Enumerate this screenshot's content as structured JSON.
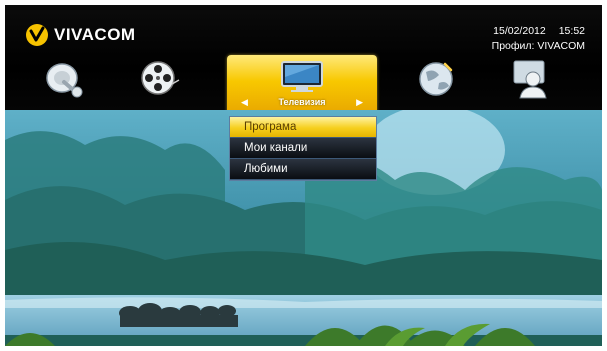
{
  "brand": {
    "logo_text": "VIVACOM",
    "accent": "#f6c200"
  },
  "status": {
    "date": "15/02/2012",
    "time": "15:52",
    "profile": "Профил: VIVACOM"
  },
  "menu": {
    "icons": [
      "radio-satellite-icon",
      "film-reel-icon",
      "tv-icon",
      "globe-icon",
      "user-profile-icon"
    ],
    "selected_label": "Телевизия"
  },
  "submenu": {
    "items": [
      {
        "label": "Програма",
        "active": true
      },
      {
        "label": "Мои канали",
        "active": false
      },
      {
        "label": "Любими",
        "active": false
      }
    ]
  }
}
